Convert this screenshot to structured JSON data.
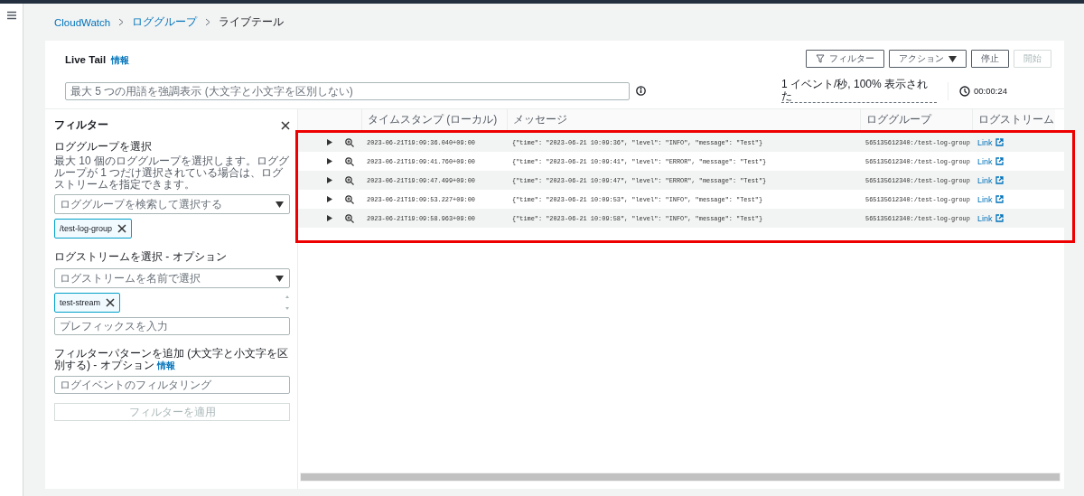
{
  "breadcrumbs": [
    {
      "label": "CloudWatch",
      "link": true
    },
    {
      "label": "ロググループ",
      "link": true
    },
    {
      "label": "ライブテール",
      "link": false
    }
  ],
  "header": {
    "title": "Live Tail",
    "info": "情報",
    "buttons": [
      {
        "label": "フィルター",
        "kind": "filter",
        "disabled": false
      },
      {
        "label": "アクション",
        "kind": "dropdown",
        "disabled": false
      },
      {
        "label": "停止",
        "kind": "plain",
        "disabled": false
      },
      {
        "label": "開始",
        "kind": "plain",
        "disabled": true
      }
    ],
    "highlight_field": {
      "placeholder": "最大 5 つの用語を強調表示 (大文字と小文字を区別しない)"
    },
    "stats": "1 イベント/秒, 100% 表示された",
    "timer": "00:00:24"
  },
  "filter_panel": {
    "title": "フィルター",
    "log_group": {
      "label": "ロググループを選択",
      "description": "最大 10 個のロググループを選択します。ロググループが 1 つだけ選択されている場合は、ログストリームを指定できます。",
      "placeholder": "ロググループを検索して選択する",
      "tokens": [
        "/test-log-group"
      ]
    },
    "log_stream": {
      "label": "ログストリームを選択 - オプション",
      "placeholder": "ログストリームを名前で選択",
      "tokens": [
        "test-stream"
      ],
      "prefix_placeholder": "プレフィックスを入力"
    },
    "pattern": {
      "label": "フィルターパターンを追加 (大文字と小文字を区別する) - オプション",
      "info": "情報",
      "placeholder": "ログイベントのフィルタリング"
    },
    "apply_button": {
      "label": "フィルターを適用",
      "disabled": true
    }
  },
  "table": {
    "columns": [
      "タイムスタンプ (ローカル)",
      "メッセージ",
      "ロググループ",
      "ログストリーム"
    ],
    "rows": [
      {
        "timestamp": "2023-06-21T19:09:36.040+09:00",
        "message": "{\"time\": \"2023-06-21 10:09:36\", \"level\": \"INFO\", \"message\": \"Test\"}",
        "log_group": "565135612340:/test-log-group",
        "log_stream": "Link"
      },
      {
        "timestamp": "2023-06-21T19:09:41.760+09:00",
        "message": "{\"time\": \"2023-06-21 10:09:41\", \"level\": \"ERROR\", \"message\": \"Test\"}",
        "log_group": "565135612340:/test-log-group",
        "log_stream": "Link"
      },
      {
        "timestamp": "2023-06-21T19:09:47.499+09:00",
        "message": "{\"time\": \"2023-06-21 10:09:47\", \"level\": \"ERROR\", \"message\": \"Test\"}",
        "log_group": "565135612340:/test-log-group",
        "log_stream": "Link"
      },
      {
        "timestamp": "2023-06-21T19:09:53.227+09:00",
        "message": "{\"time\": \"2023-06-21 10:09:53\", \"level\": \"INFO\", \"message\": \"Test\"}",
        "log_group": "565135612340:/test-log-group",
        "log_stream": "Link"
      },
      {
        "timestamp": "2023-06-21T19:09:58.963+09:00",
        "message": "{\"time\": \"2023-06-21 10:09:58\", \"level\": \"INFO\", \"message\": \"Test\"}",
        "log_group": "565135612340:/test-log-group",
        "log_stream": "Link"
      }
    ]
  }
}
